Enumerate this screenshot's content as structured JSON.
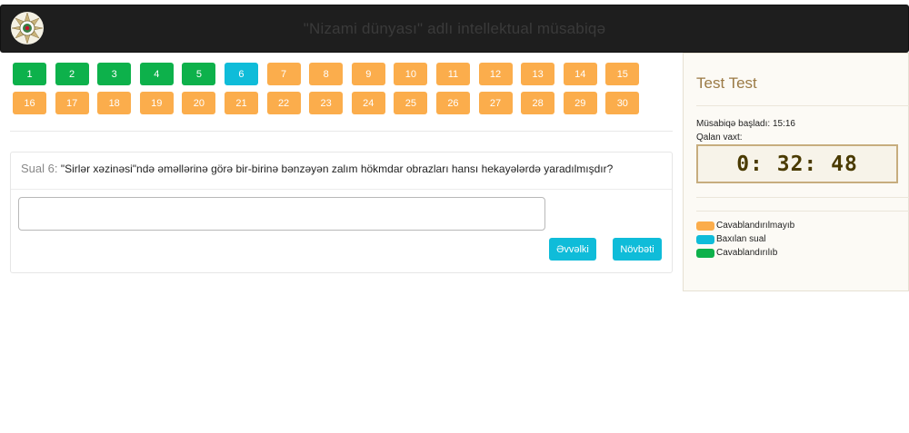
{
  "header": {
    "title": "\"Nizami dünyası\" adlı intellektual müsabiqə"
  },
  "questions": {
    "row1": [
      {
        "n": "1",
        "status": "green"
      },
      {
        "n": "2",
        "status": "green"
      },
      {
        "n": "3",
        "status": "green"
      },
      {
        "n": "4",
        "status": "green"
      },
      {
        "n": "5",
        "status": "green"
      },
      {
        "n": "6",
        "status": "blue"
      },
      {
        "n": "7",
        "status": "orange"
      },
      {
        "n": "8",
        "status": "orange"
      },
      {
        "n": "9",
        "status": "orange"
      },
      {
        "n": "10",
        "status": "orange"
      },
      {
        "n": "11",
        "status": "orange"
      },
      {
        "n": "12",
        "status": "orange"
      },
      {
        "n": "13",
        "status": "orange"
      },
      {
        "n": "14",
        "status": "orange"
      },
      {
        "n": "15",
        "status": "orange"
      }
    ],
    "row2": [
      {
        "n": "16",
        "status": "orange"
      },
      {
        "n": "17",
        "status": "orange"
      },
      {
        "n": "18",
        "status": "orange"
      },
      {
        "n": "19",
        "status": "orange"
      },
      {
        "n": "20",
        "status": "orange"
      },
      {
        "n": "21",
        "status": "orange"
      },
      {
        "n": "22",
        "status": "orange"
      },
      {
        "n": "23",
        "status": "orange"
      },
      {
        "n": "24",
        "status": "orange"
      },
      {
        "n": "25",
        "status": "orange"
      },
      {
        "n": "26",
        "status": "orange"
      },
      {
        "n": "27",
        "status": "orange"
      },
      {
        "n": "28",
        "status": "orange"
      },
      {
        "n": "29",
        "status": "orange"
      },
      {
        "n": "30",
        "status": "orange"
      }
    ]
  },
  "question": {
    "prefix": "Sual 6:",
    "text": "\"Sirlər xəzinəsi\"ndə əməllərinə görə bir-birinə bənzəyən zalım hökmdar obrazları hansı hekayələrdə yaradılmışdır?",
    "answer_value": "",
    "prev_label": "Əvvəlki",
    "next_label": "Növbəti"
  },
  "sidebar": {
    "user_name": "Test Test",
    "started_label": "Müsabiqə başladı: 15:16",
    "remaining_label": "Qalan vaxt:",
    "timer": "0: 32: 48",
    "legend": [
      {
        "label": "Cavablandırılmayıb",
        "color": "#fbad4c"
      },
      {
        "label": "Baxılan sual",
        "color": "#0fbcd9"
      },
      {
        "label": "Cavablandırılıb",
        "color": "#0db14b"
      }
    ]
  },
  "colors": {
    "answered": "#0db14b",
    "current": "#0fbcd9",
    "unanswered": "#fbad4c",
    "navbar": "#1e1e1e",
    "accent_gold": "#9b7a45"
  },
  "icons": {
    "logo": "emblem-icon"
  }
}
